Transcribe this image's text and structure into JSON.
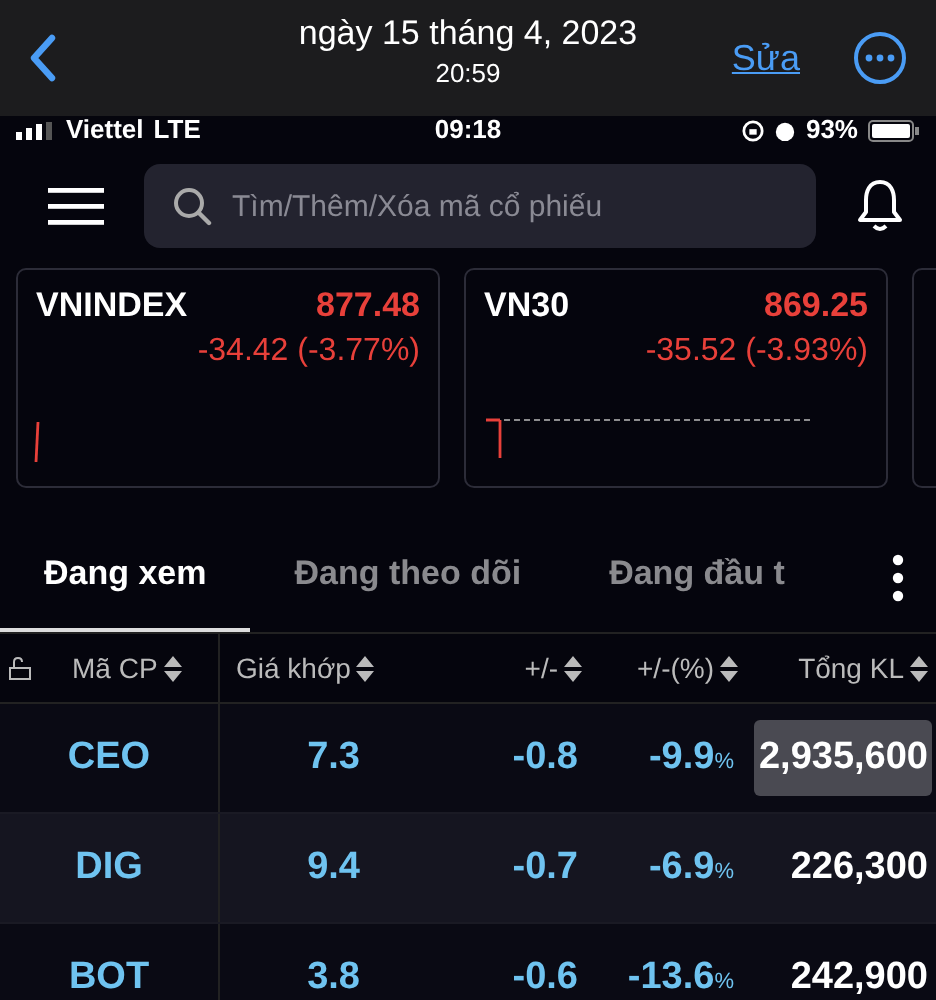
{
  "viewer": {
    "title": "ngày 15 tháng 4, 2023",
    "time": "20:59",
    "edit": "Sửa"
  },
  "status_bar": {
    "carrier": "Viettel",
    "network": "LTE",
    "clock": "09:18",
    "battery": "93%"
  },
  "search": {
    "placeholder": "Tìm/Thêm/Xóa mã cổ phiếu"
  },
  "indices": [
    {
      "name": "VNINDEX",
      "value": "877.48",
      "change": "-34.42 (-3.77%)",
      "color": "#e8403a"
    },
    {
      "name": "VN30",
      "value": "869.25",
      "change": "-35.52 (-3.93%)",
      "color": "#e8403a"
    }
  ],
  "tabs": [
    {
      "label": "Đang xem",
      "selected": true
    },
    {
      "label": "Đang theo dõi",
      "selected": false
    },
    {
      "label": "Đang đầu t",
      "selected": false
    }
  ],
  "table": {
    "columns": [
      "Mã CP",
      "Giá khớp",
      "+/-",
      "+/-(%)",
      "Tổng KL"
    ],
    "rows": [
      {
        "symbol": "CEO",
        "price": "7.3",
        "change": "-0.8",
        "pct": "-9.9",
        "pct_unit": "%",
        "volume": "2,935,600",
        "highlighted": true
      },
      {
        "symbol": "DIG",
        "price": "9.4",
        "change": "-0.7",
        "pct": "-6.9",
        "pct_unit": "%",
        "volume": "226,300",
        "highlighted": false
      },
      {
        "symbol": "BOT",
        "price": "3.8",
        "change": "-0.6",
        "pct": "-13.6",
        "pct_unit": "%",
        "volume": "242,900",
        "highlighted": false
      }
    ]
  }
}
